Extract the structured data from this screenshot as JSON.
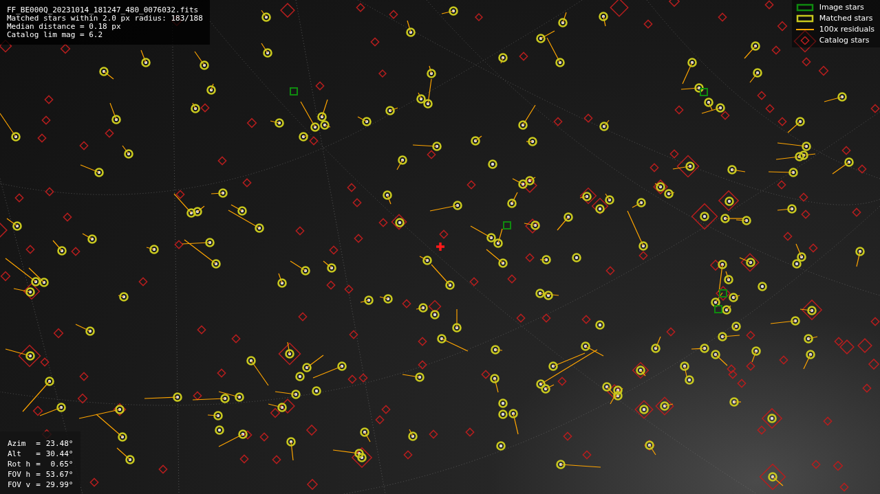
{
  "info": {
    "file_name": "FF_BE000Q_20231014_181247_480_0076032.fits",
    "lines": [
      "Matched stars within 2.0 px radius: 183/188",
      "Median distance = 0.18 px",
      "Catalog lim mag = 6.2"
    ]
  },
  "legend": [
    {
      "kind": "image",
      "label": "Image stars",
      "color": "#0f8a0f"
    },
    {
      "kind": "matched",
      "label": "Matched stars",
      "color": "#c8c81e"
    },
    {
      "kind": "residual",
      "label": "100x residuals",
      "color": "#ffa500"
    },
    {
      "kind": "catalog",
      "label": "Catalog stars",
      "color": "#b41e1e"
    }
  ],
  "pointing": [
    {
      "label": "Azim",
      "separator": "=",
      "value": "23.48°"
    },
    {
      "label": "Alt",
      "separator": "=",
      "value": "30.44°"
    },
    {
      "label": "Rot h",
      "separator": "=",
      "value": "0.65°"
    },
    {
      "label": "FOV h",
      "separator": "=",
      "value": "53.67°"
    },
    {
      "label": "FOV v",
      "separator": "=",
      "value": "29.99°"
    }
  ]
}
